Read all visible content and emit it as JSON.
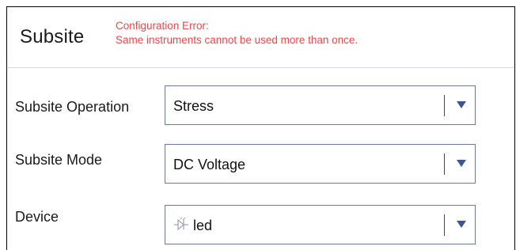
{
  "header": {
    "title": "Subsite",
    "error_line1": "Configuration Error:",
    "error_line2": "Same instruments cannot be used more than once."
  },
  "fields": [
    {
      "label": "Subsite Operation",
      "value": "Stress"
    },
    {
      "label": "Subsite Mode",
      "value": "DC Voltage"
    },
    {
      "label": "Device",
      "value": "led",
      "icon": "led-diode-icon"
    }
  ],
  "colors": {
    "error": "#e84a4a",
    "select_border": "#6b7a99",
    "arrow": "#3e5590"
  }
}
